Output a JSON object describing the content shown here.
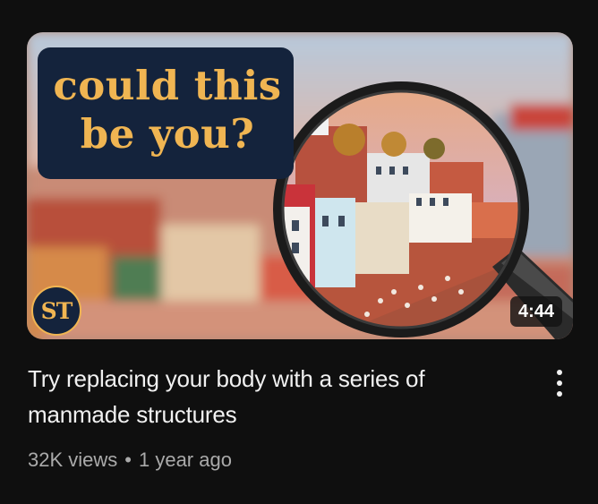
{
  "video": {
    "thumbnail": {
      "caption_line1": "could this",
      "caption_line2": "be you?",
      "channel_logo": "ST",
      "duration": "4:44",
      "colors": {
        "caption_bg": "#14233c",
        "caption_text": "#f0b552"
      }
    },
    "title": "Try replacing your body with a series of manmade structures",
    "views": "32K views",
    "separator": "•",
    "age": "1 year ago",
    "menu_icon": "more-vertical-icon"
  }
}
